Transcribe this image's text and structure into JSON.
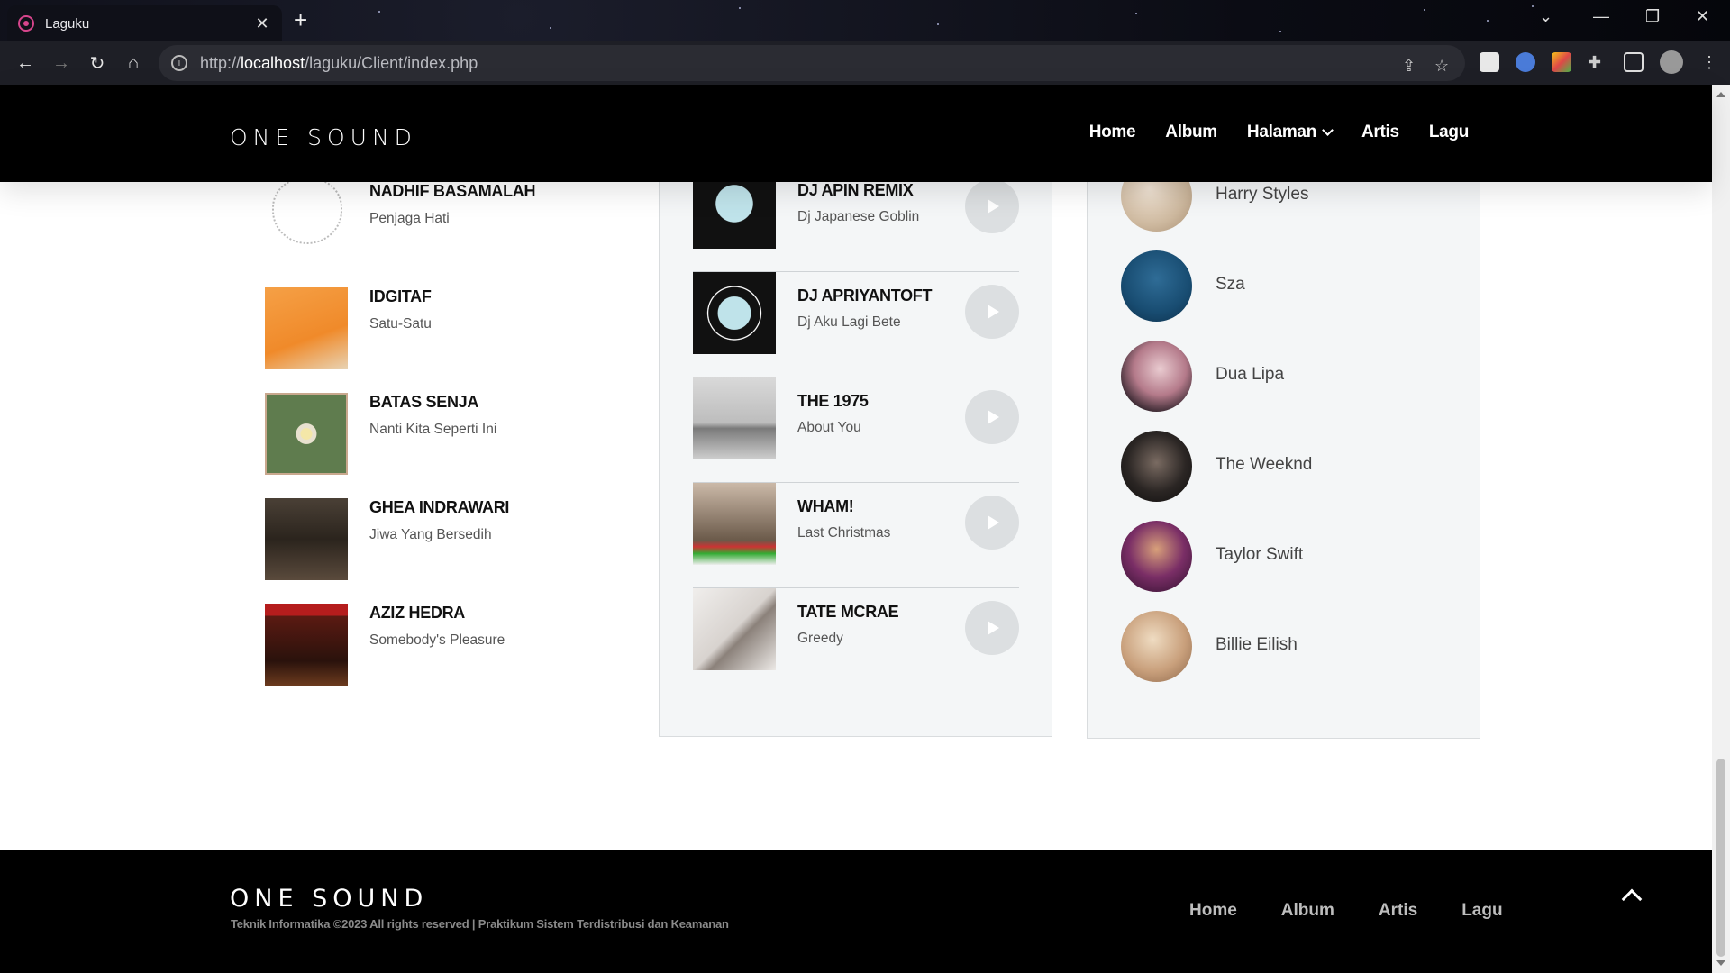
{
  "browser": {
    "tab_title": "Laguku",
    "url_prefix": "http://",
    "url_host": "localhost",
    "url_path": "/laguku/Client/index.php"
  },
  "header": {
    "brand": "ONE SOUND",
    "nav": [
      "Home",
      "Album",
      "Halaman",
      "Artis",
      "Lagu"
    ]
  },
  "recommended": [
    {
      "title": "NADHIF BASAMALAH",
      "subtitle": "Penjaga Hati"
    },
    {
      "title": "IDGITAF",
      "subtitle": "Satu-Satu"
    },
    {
      "title": "BATAS SENJA",
      "subtitle": "Nanti Kita Seperti Ini"
    },
    {
      "title": "GHEA INDRAWARI",
      "subtitle": "Jiwa Yang Bersedih"
    },
    {
      "title": "AZIZ HEDRA",
      "subtitle": "Somebody's Pleasure"
    }
  ],
  "songs": [
    {
      "title": "DJ APIN REMIX",
      "subtitle": "Dj Japanese Goblin"
    },
    {
      "title": "DJ APRIYANTOFT",
      "subtitle": "Dj Aku Lagi Bete"
    },
    {
      "title": "THE 1975",
      "subtitle": "About You"
    },
    {
      "title": "WHAM!",
      "subtitle": "Last Christmas"
    },
    {
      "title": "TATE MCRAE",
      "subtitle": "Greedy"
    }
  ],
  "artists": [
    "Harry Styles",
    "Sza",
    "Dua Lipa",
    "The Weeknd",
    "Taylor Swift",
    "Billie Eilish"
  ],
  "footer": {
    "brand": "ONE SOUND",
    "copyright": "Teknik Informatika ©2023 All rights reserved | Praktikum Sistem Terdistribusi dan Keamanan",
    "nav": [
      "Home",
      "Album",
      "Artis",
      "Lagu"
    ]
  }
}
